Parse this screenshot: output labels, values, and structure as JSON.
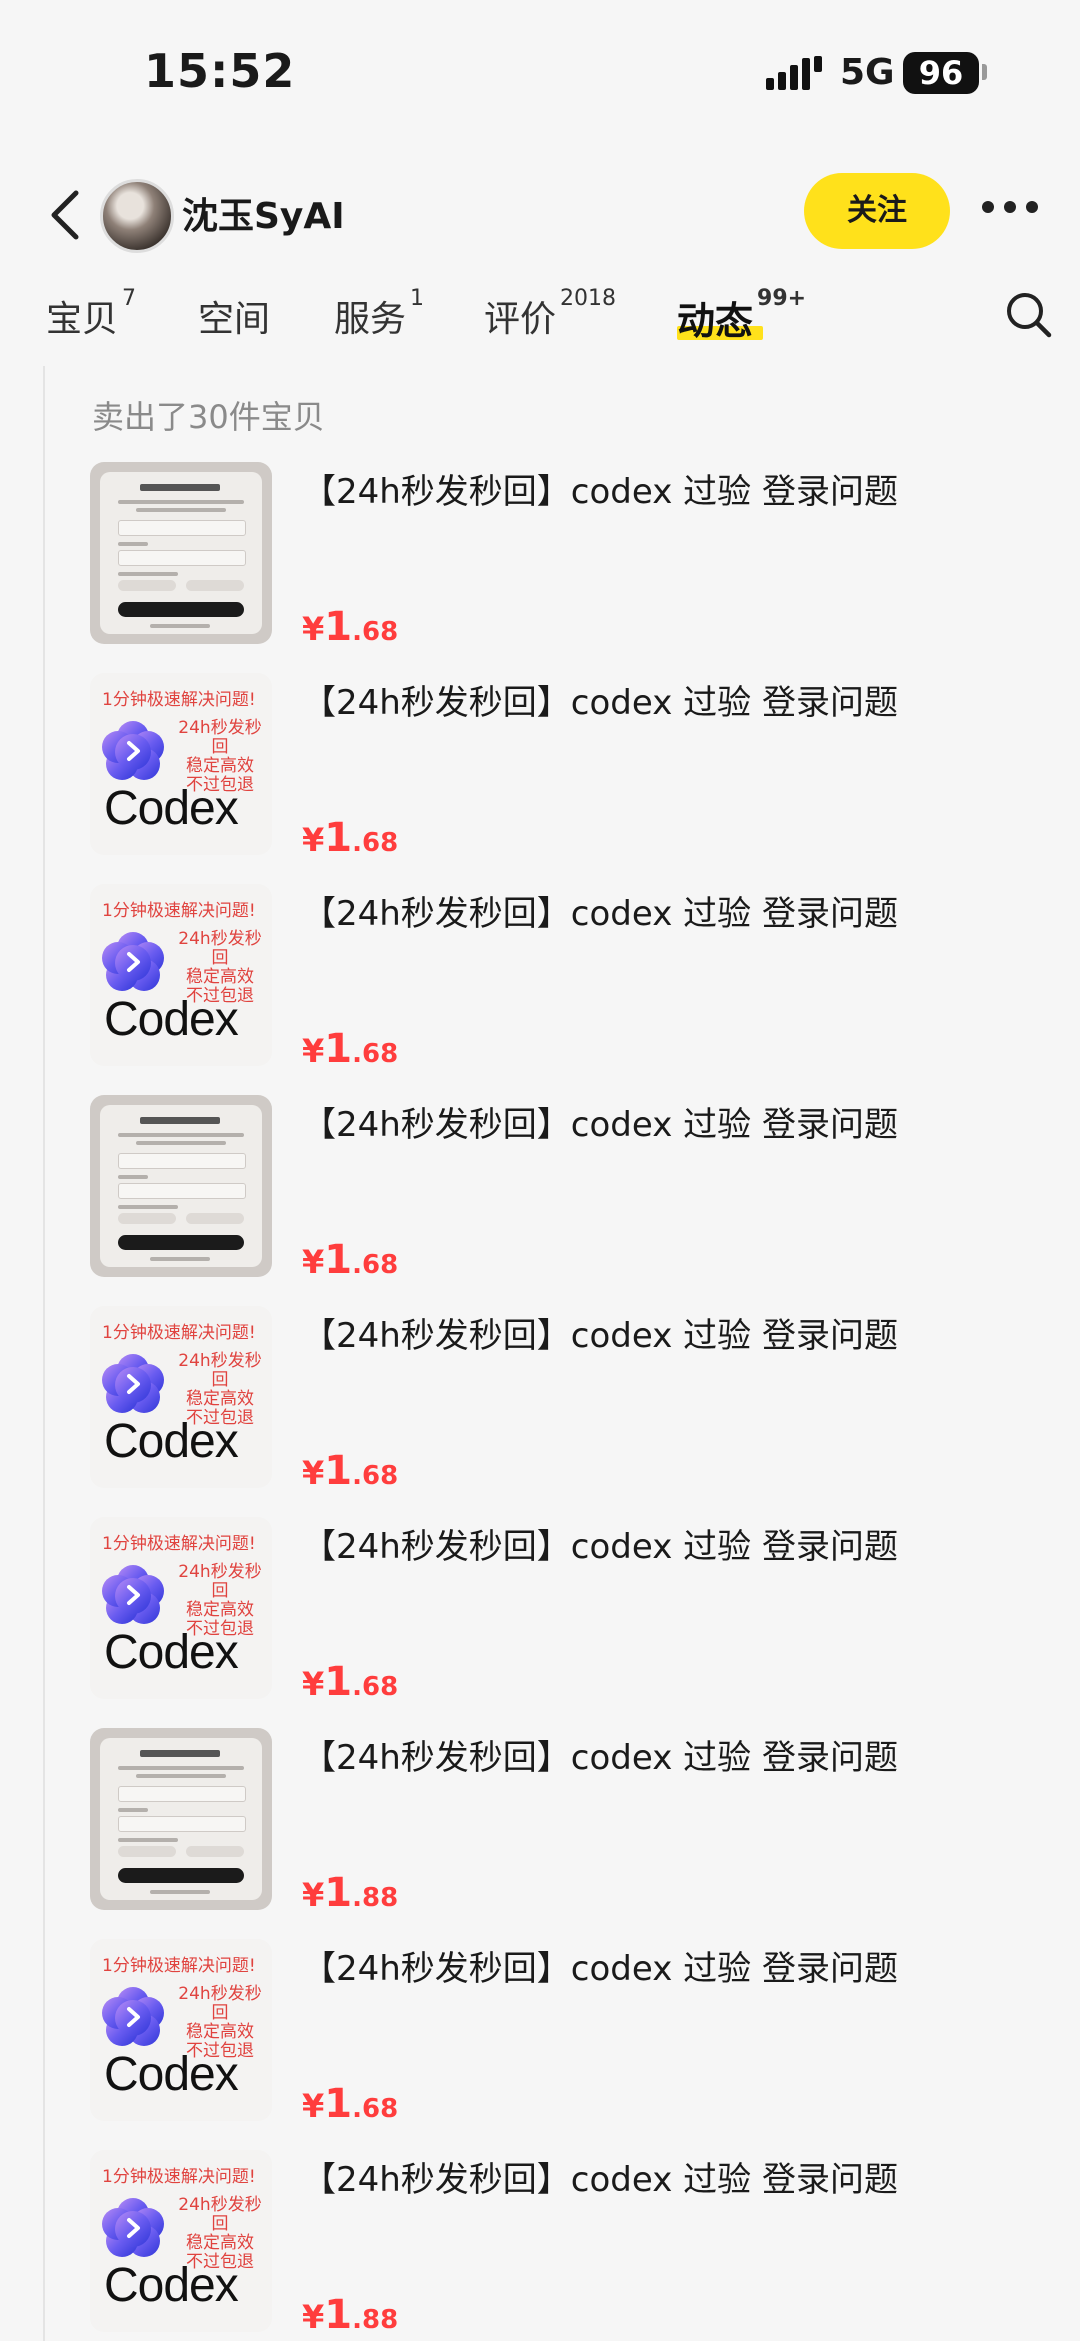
{
  "status_bar": {
    "time": "15:52",
    "network": "5G",
    "battery": "96"
  },
  "header": {
    "name": "沈玉SyAI",
    "follow_label": "关注"
  },
  "tabs": [
    {
      "label": "宝贝",
      "count": "7"
    },
    {
      "label": "空间",
      "count": ""
    },
    {
      "label": "服务",
      "count": "1"
    },
    {
      "label": "评价",
      "count": "2018"
    },
    {
      "label": "动态",
      "count": "99+"
    }
  ],
  "sold_label": "卖出了30件宝贝",
  "promo_text": {
    "line1": "1分钟极速解决问题!",
    "line2": "24h秒发秒回",
    "line3": "稳定高效",
    "line4": "不过包退",
    "brand": "Codex"
  },
  "items": [
    {
      "title": "【24h秒发秒回】codex 过验 登录问题",
      "currency": "¥",
      "price_int": "1",
      "price_dec": ".68",
      "thumb": "login-screenshot"
    },
    {
      "title": "【24h秒发秒回】codex 过验 登录问题",
      "currency": "¥",
      "price_int": "1",
      "price_dec": ".68",
      "thumb": "codex-promo"
    },
    {
      "title": "【24h秒发秒回】codex 过验 登录问题",
      "currency": "¥",
      "price_int": "1",
      "price_dec": ".68",
      "thumb": "codex-promo"
    },
    {
      "title": "【24h秒发秒回】codex 过验 登录问题",
      "currency": "¥",
      "price_int": "1",
      "price_dec": ".68",
      "thumb": "login-screenshot"
    },
    {
      "title": "【24h秒发秒回】codex 过验 登录问题",
      "currency": "¥",
      "price_int": "1",
      "price_dec": ".68",
      "thumb": "codex-promo"
    },
    {
      "title": "【24h秒发秒回】codex 过验 登录问题",
      "currency": "¥",
      "price_int": "1",
      "price_dec": ".68",
      "thumb": "codex-promo"
    },
    {
      "title": "【24h秒发秒回】codex 过验 登录问题",
      "currency": "¥",
      "price_int": "1",
      "price_dec": ".88",
      "thumb": "login-screenshot"
    },
    {
      "title": "【24h秒发秒回】codex 过验 登录问题",
      "currency": "¥",
      "price_int": "1",
      "price_dec": ".68",
      "thumb": "codex-promo"
    },
    {
      "title": "【24h秒发秒回】codex 过验 登录问题",
      "currency": "¥",
      "price_int": "1",
      "price_dec": ".88",
      "thumb": "codex-promo"
    }
  ],
  "colors": {
    "accent": "#ffe11b",
    "price": "#ff3d3d"
  }
}
